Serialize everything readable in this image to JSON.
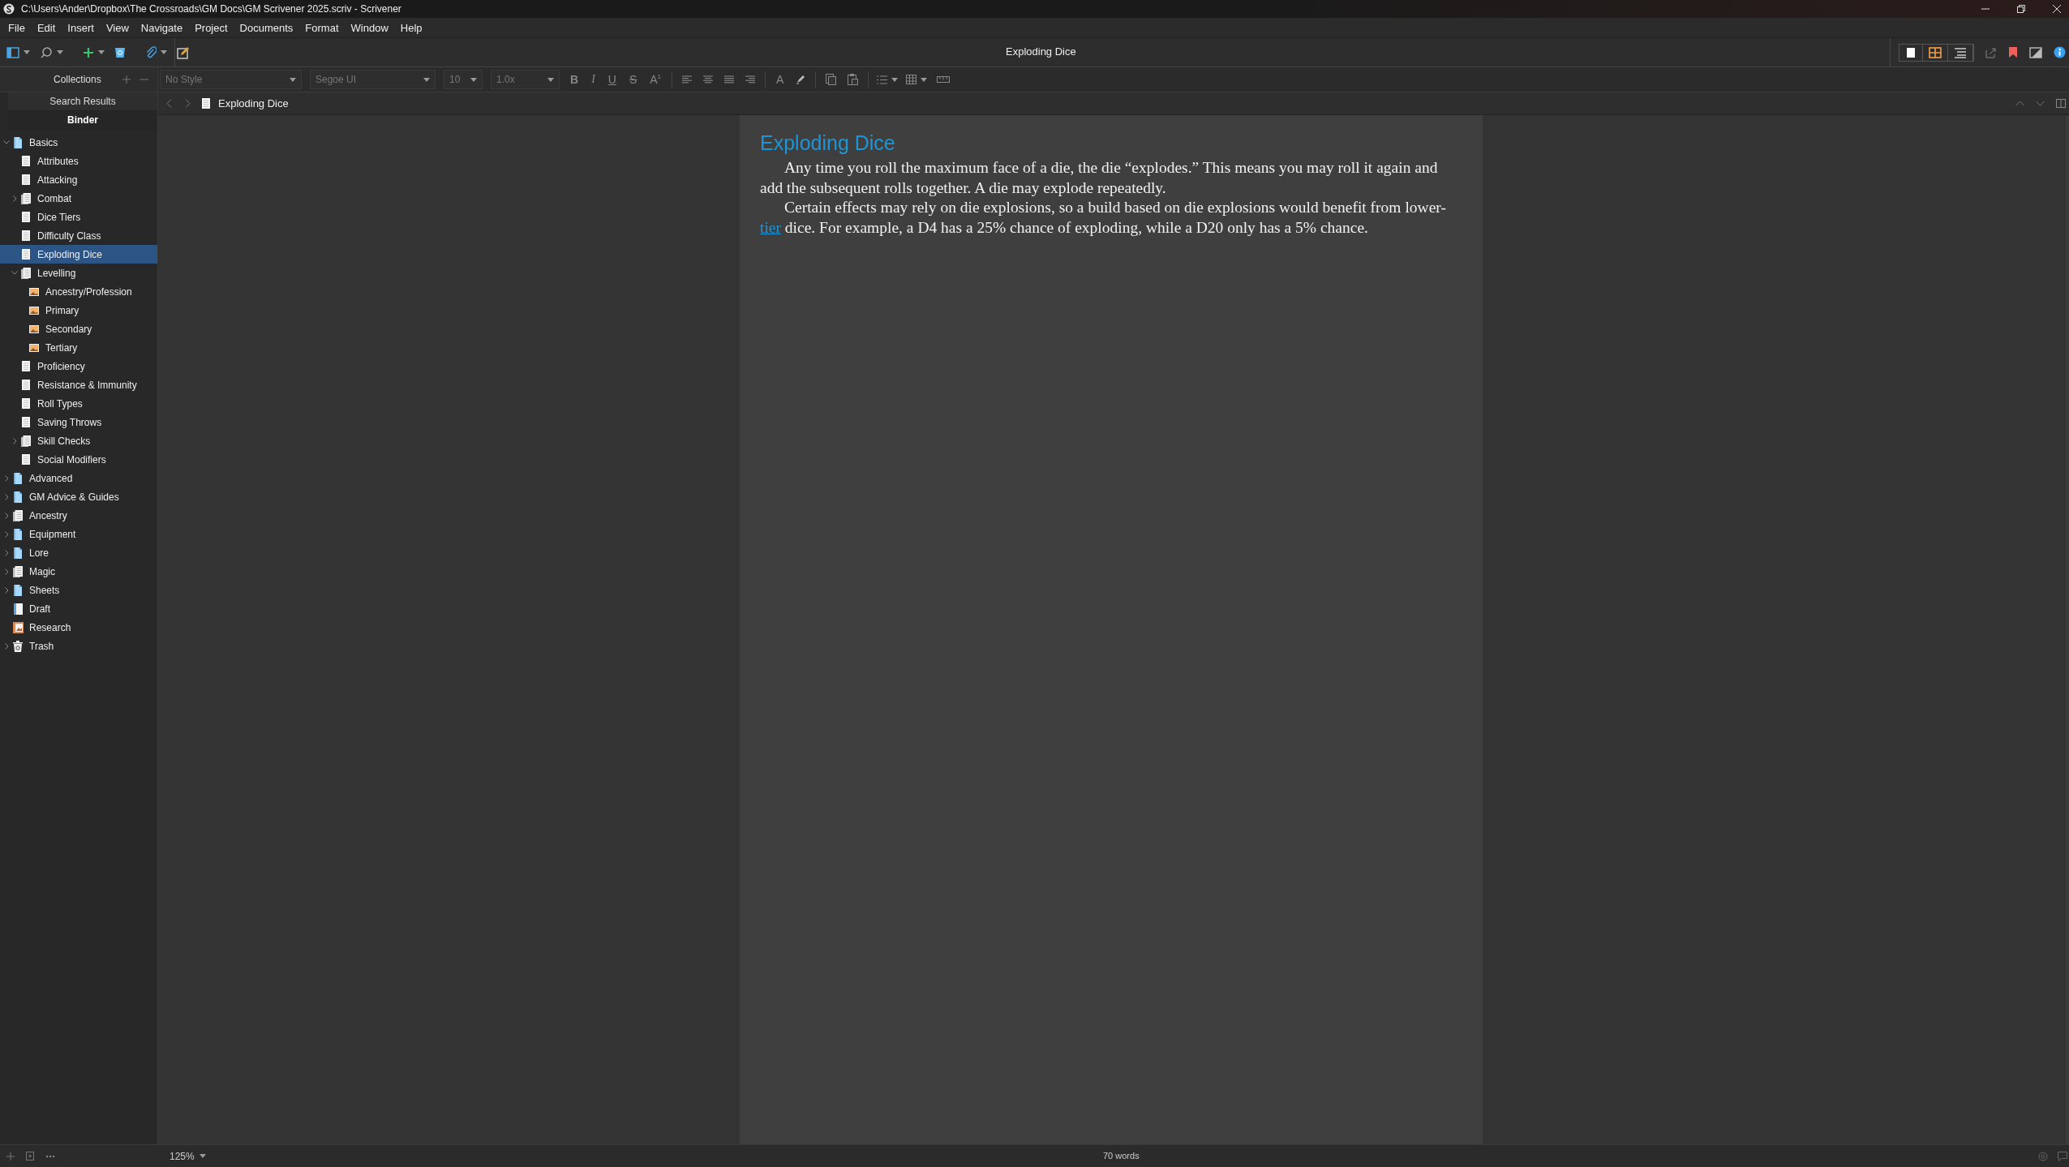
{
  "window": {
    "title": "C:\\Users\\Ander\\Dropbox\\The Crossroads\\GM Docs\\GM Scrivener 2025.scriv - Scrivener"
  },
  "menu": [
    "File",
    "Edit",
    "Insert",
    "View",
    "Navigate",
    "Project",
    "Documents",
    "Format",
    "Window",
    "Help"
  ],
  "toolbar": {
    "document_title": "Exploding Dice"
  },
  "binder": {
    "collections_label": "Collections",
    "tabs": [
      {
        "label": "Search Results",
        "selected": false
      },
      {
        "label": "Binder",
        "selected": true
      }
    ],
    "items": [
      {
        "label": "Basics",
        "kind": "folder",
        "expanded": true,
        "selected": false,
        "children": [
          {
            "label": "Attributes",
            "kind": "doc",
            "selected": false
          },
          {
            "label": "Attacking",
            "kind": "doc",
            "selected": false
          },
          {
            "label": "Combat",
            "kind": "stack",
            "expanded": false,
            "selected": false
          },
          {
            "label": "Dice Tiers",
            "kind": "doc",
            "selected": false
          },
          {
            "label": "Difficulty Class",
            "kind": "doc",
            "selected": false
          },
          {
            "label": "Exploding Dice",
            "kind": "doc",
            "selected": true
          },
          {
            "label": "Levelling",
            "kind": "stack",
            "expanded": true,
            "selected": false,
            "children": [
              {
                "label": "Ancestry/Profession",
                "kind": "image",
                "selected": false
              },
              {
                "label": "Primary",
                "kind": "image",
                "selected": false
              },
              {
                "label": "Secondary",
                "kind": "image",
                "selected": false
              },
              {
                "label": "Tertiary",
                "kind": "image",
                "selected": false
              }
            ]
          },
          {
            "label": "Proficiency",
            "kind": "doc",
            "selected": false
          },
          {
            "label": "Resistance & Immunity",
            "kind": "doc",
            "selected": false
          },
          {
            "label": "Roll Types",
            "kind": "doc",
            "selected": false
          },
          {
            "label": "Saving Throws",
            "kind": "doc",
            "selected": false
          },
          {
            "label": "Skill Checks",
            "kind": "stack",
            "expanded": false,
            "selected": false
          },
          {
            "label": "Social Modifiers",
            "kind": "doc",
            "selected": false
          }
        ]
      },
      {
        "label": "Advanced",
        "kind": "folder",
        "expanded": false,
        "selected": false
      },
      {
        "label": "GM Advice & Guides",
        "kind": "folder",
        "expanded": false,
        "selected": false
      },
      {
        "label": "Ancestry",
        "kind": "stack",
        "expanded": false,
        "selected": false
      },
      {
        "label": "Equipment",
        "kind": "folder",
        "expanded": false,
        "selected": false
      },
      {
        "label": "Lore",
        "kind": "folder",
        "expanded": false,
        "selected": false
      },
      {
        "label": "Magic",
        "kind": "stack",
        "expanded": false,
        "selected": false
      },
      {
        "label": "Sheets",
        "kind": "folder",
        "expanded": false,
        "selected": false
      },
      {
        "label": "Draft",
        "kind": "draft",
        "selected": false
      },
      {
        "label": "Research",
        "kind": "research",
        "selected": false
      },
      {
        "label": "Trash",
        "kind": "trash",
        "expanded": false,
        "selected": false
      }
    ]
  },
  "format_bar": {
    "style": "No Style",
    "font": "Segoe UI",
    "size": "10",
    "spacing": "1.0x",
    "text_buttons": [
      "B",
      "I",
      "U",
      "S",
      "A$^{1}$"
    ],
    "color_button": "A"
  },
  "editor": {
    "header_title": "Exploding Dice",
    "heading": "Exploding Dice",
    "paragraphs": [
      [
        {
          "text": "Any time you roll the maximum face of a die, the die “explodes.” This means you may roll it again and add the subsequent rolls together. A die may explode repeatedly."
        }
      ],
      [
        {
          "text": "Certain effects may rely on die explosions, so a build based on die explosions would benefit from lower-"
        },
        {
          "text": "tier",
          "link": true
        },
        {
          "text": " dice. For example, a D4 has a 25% chance of exploding, while a D20 only has a 5% chance."
        }
      ]
    ]
  },
  "status_bar": {
    "zoom": "125%",
    "word_count": "70 words"
  }
}
